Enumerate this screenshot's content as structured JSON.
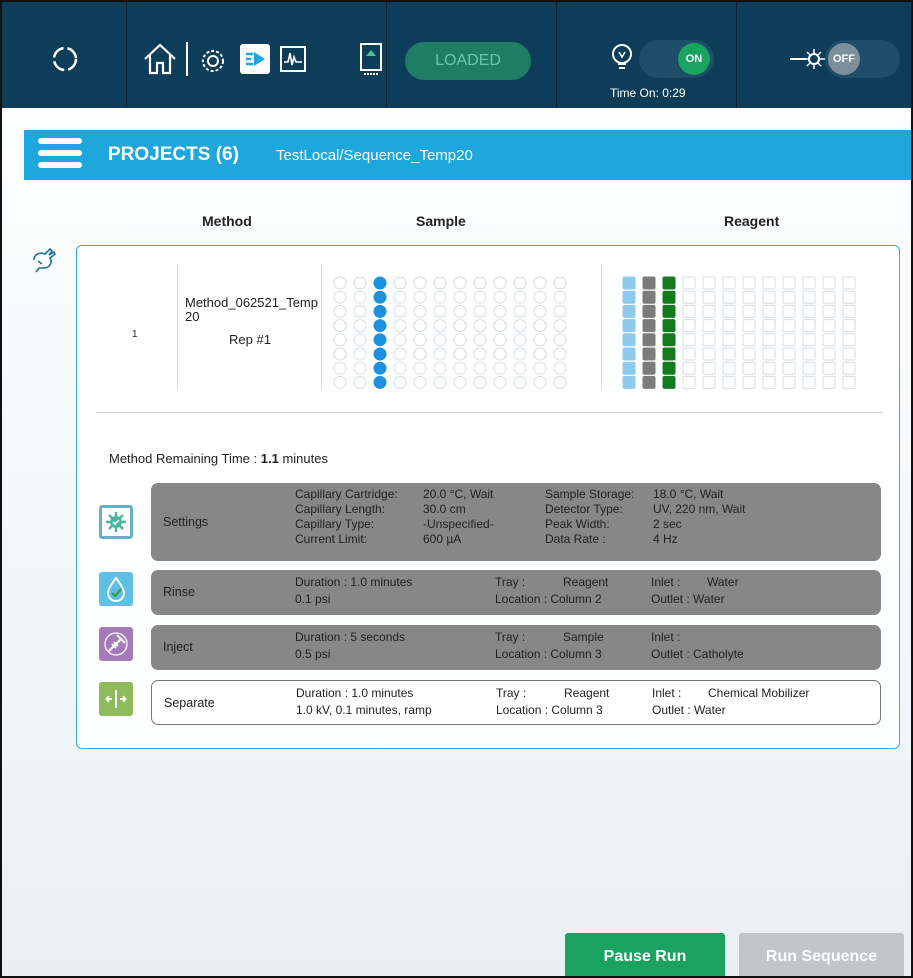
{
  "topbar": {
    "loaded_label": "LOADED",
    "lamp_toggle": "ON",
    "time_on": "Time On: 0:29",
    "laser_toggle": "OFF"
  },
  "header": {
    "title": "PROJECTS (6)",
    "path": "TestLocal/Sequence_Temp20"
  },
  "columns": {
    "method": "Method",
    "sample": "Sample",
    "reagent": "Reagent"
  },
  "row": {
    "number": "1",
    "method_name": "Method_062521_Temp20",
    "rep": "Rep #1"
  },
  "sample_plate": {
    "columns": 12,
    "rows": 8,
    "active_column": 3,
    "active_color": "#1e90e0"
  },
  "reagent_plate": {
    "columns": 12,
    "rows": 8,
    "filled": [
      {
        "column": 1,
        "color": "#8ec9ee"
      },
      {
        "column": 2,
        "color": "#7b7b7b"
      },
      {
        "column": 3,
        "color": "#137a1f"
      }
    ]
  },
  "remaining": {
    "label": "Method Remaining Time :",
    "value": "1.1",
    "unit": "minutes"
  },
  "steps": {
    "settings": {
      "name": "Settings",
      "l1": "Capillary Cartridge:",
      "v1": "20.0 °C, Wait",
      "l2": "Capillary Length:",
      "v2": "30.0 cm",
      "l3": "Capillary Type:",
      "v3": "-Unspecified-",
      "l4": "Current Limit:",
      "v4": "600 µA",
      "l5": "Sample Storage:",
      "v5": "18.0 °C, Wait",
      "l6": "Detector Type:",
      "v6": "UV, 220 nm, Wait",
      "l7": "Peak Width:",
      "v7": "2 sec",
      "l8": "Data Rate :",
      "v8": "4 Hz"
    },
    "rinse": {
      "name": "Rinse",
      "duration": "Duration : 1.0 minutes",
      "pressure": "0.1 psi",
      "tray_label": "Tray :",
      "tray": "Reagent",
      "location": "Location : Column 2",
      "inlet_label": "Inlet :",
      "inlet": "Water",
      "outlet": "Outlet : Water"
    },
    "inject": {
      "name": "Inject",
      "duration": "Duration : 5 seconds",
      "pressure": "0.5 psi",
      "tray_label": "Tray :",
      "tray": "Sample",
      "location": "Location : Column 3",
      "inlet_label": "Inlet :",
      "inlet": "",
      "outlet": "Outlet : Catholyte"
    },
    "separate": {
      "name": "Separate",
      "duration": "Duration : 1.0 minutes",
      "pressure": "1.0 kV, 0.1 minutes, ramp",
      "tray_label": "Tray :",
      "tray": "Reagent",
      "location": "Location : Column 3",
      "inlet_label": "Inlet :",
      "inlet": "Chemical Mobilizer",
      "outlet": "Outlet : Water"
    }
  },
  "buttons": {
    "pause": "Pause Run",
    "run": "Run Sequence"
  },
  "colors": {
    "topbar": "#0d3d58",
    "header": "#1ea7dc",
    "pause": "#1aa260",
    "run_disabled": "#bfc7cc"
  }
}
